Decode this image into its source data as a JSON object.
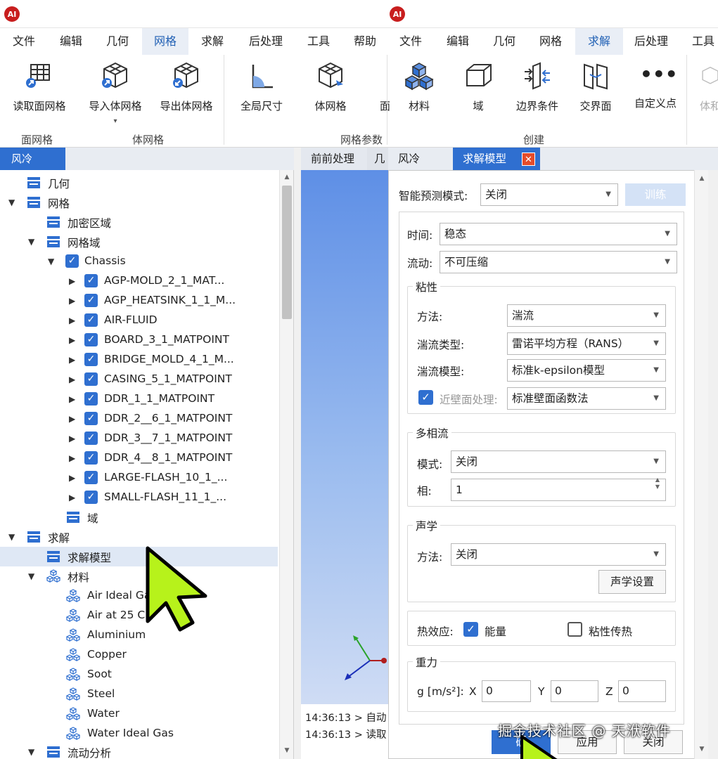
{
  "menus": {
    "left": [
      "文件",
      "编辑",
      "几何",
      "网格",
      "求解",
      "后处理",
      "工具",
      "帮助"
    ],
    "right": [
      "文件",
      "编辑",
      "几何",
      "网格",
      "求解",
      "后处理",
      "工具"
    ]
  },
  "ribbon": {
    "left_buttons": [
      "读取面网格",
      "导入体网格",
      "导出体网格",
      "全局尺寸",
      "体网格"
    ],
    "left_groups": [
      "面网格",
      "体网格",
      "网格参数"
    ],
    "right_buttons": [
      "材料",
      "域",
      "边界条件",
      "交界面",
      "自定义点",
      "体和"
    ],
    "right_groups": [
      "创建"
    ]
  },
  "left_panel": {
    "tab": "风冷",
    "tree": {
      "geometry": "几何",
      "mesh": "网格",
      "refine": "加密区域",
      "mesh_domain": "网格域",
      "chassis": "Chassis",
      "parts": [
        "AGP-MOLD_2_1_MAT...",
        "AGP_HEATSINK_1_1_M...",
        "AIR-FLUID",
        "BOARD_3_1_MATPOINT",
        "BRIDGE_MOLD_4_1_M...",
        "CASING_5_1_MATPOINT",
        "DDR_1_1_MATPOINT",
        "DDR_2__6_1_MATPOINT",
        "DDR_3__7_1_MATPOINT",
        "DDR_4__8_1_MATPOINT",
        "LARGE-FLASH_10_1_...",
        "SMALL-FLASH_11_1_..."
      ],
      "domain": "域",
      "solve": "求解",
      "solve_model": "求解模型",
      "materials": "材料",
      "material_list": [
        "Air Ideal Gas",
        "Air at 25 C",
        "Aluminium",
        "Copper",
        "Soot",
        "Steel",
        "Water",
        "Water Ideal Gas"
      ],
      "flow_analysis": "流动分析"
    }
  },
  "center": {
    "tabs": [
      "前前处理",
      "几"
    ],
    "log": [
      "14:36:13 > 自动",
      "14:36:13 > 读取"
    ]
  },
  "right_tabs": [
    "风冷",
    "求解模型"
  ],
  "dialog": {
    "smart_label": "智能预测模式:",
    "smart_value": "关闭",
    "train": "训练",
    "time_label": "时间:",
    "time_value": "稳态",
    "flow_label": "流动:",
    "flow_value": "不可压缩",
    "viscosity": {
      "title": "粘性",
      "method_label": "方法:",
      "method_value": "湍流",
      "type_label": "湍流类型:",
      "type_value": "雷诺平均方程（RANS）",
      "model_label": "湍流模型:",
      "model_value": "标准k-epsilon模型",
      "wall_label": "近壁面处理:",
      "wall_value": "标准壁面函数法"
    },
    "multiphase": {
      "title": "多相流",
      "mode_label": "模式:",
      "mode_value": "关闭",
      "phase_label": "相:",
      "phase_value": "1"
    },
    "acoustics": {
      "title": "声学",
      "method_label": "方法:",
      "method_value": "关闭",
      "settings": "声学设置"
    },
    "thermal": {
      "label": "热效应:",
      "energy": "能量",
      "viscous_heating": "粘性传热"
    },
    "gravity": {
      "title": "重力",
      "label": "g [m/s²]:",
      "x_label": "X",
      "x": "0",
      "y_label": "Y",
      "y": "0",
      "z_label": "Z",
      "z": "0"
    },
    "buttons": [
      "确",
      "应用",
      "关闭"
    ]
  },
  "watermark": "掘金技术社区 @ 天洑软件",
  "colors": {
    "accent": "#2f6fd0",
    "cursor": "#b7f21b"
  }
}
